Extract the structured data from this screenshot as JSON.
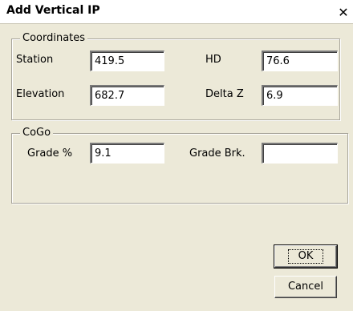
{
  "window": {
    "title": "Add Vertical IP",
    "close_glyph": "✕"
  },
  "coordinates": {
    "legend": "Coordinates",
    "station_label": "Station",
    "station_value": "419.5",
    "hd_label": "HD",
    "hd_value": "76.6",
    "elevation_label": "Elevation",
    "elevation_value": "682.7",
    "delta_z_label": "Delta Z",
    "delta_z_value": "6.9"
  },
  "cogo": {
    "legend": "CoGo",
    "grade_label": "Grade %",
    "grade_value": "9.1",
    "grade_brk_label": "Grade Brk.",
    "grade_brk_value": ""
  },
  "buttons": {
    "ok_label": "OK",
    "cancel_label": "Cancel"
  }
}
